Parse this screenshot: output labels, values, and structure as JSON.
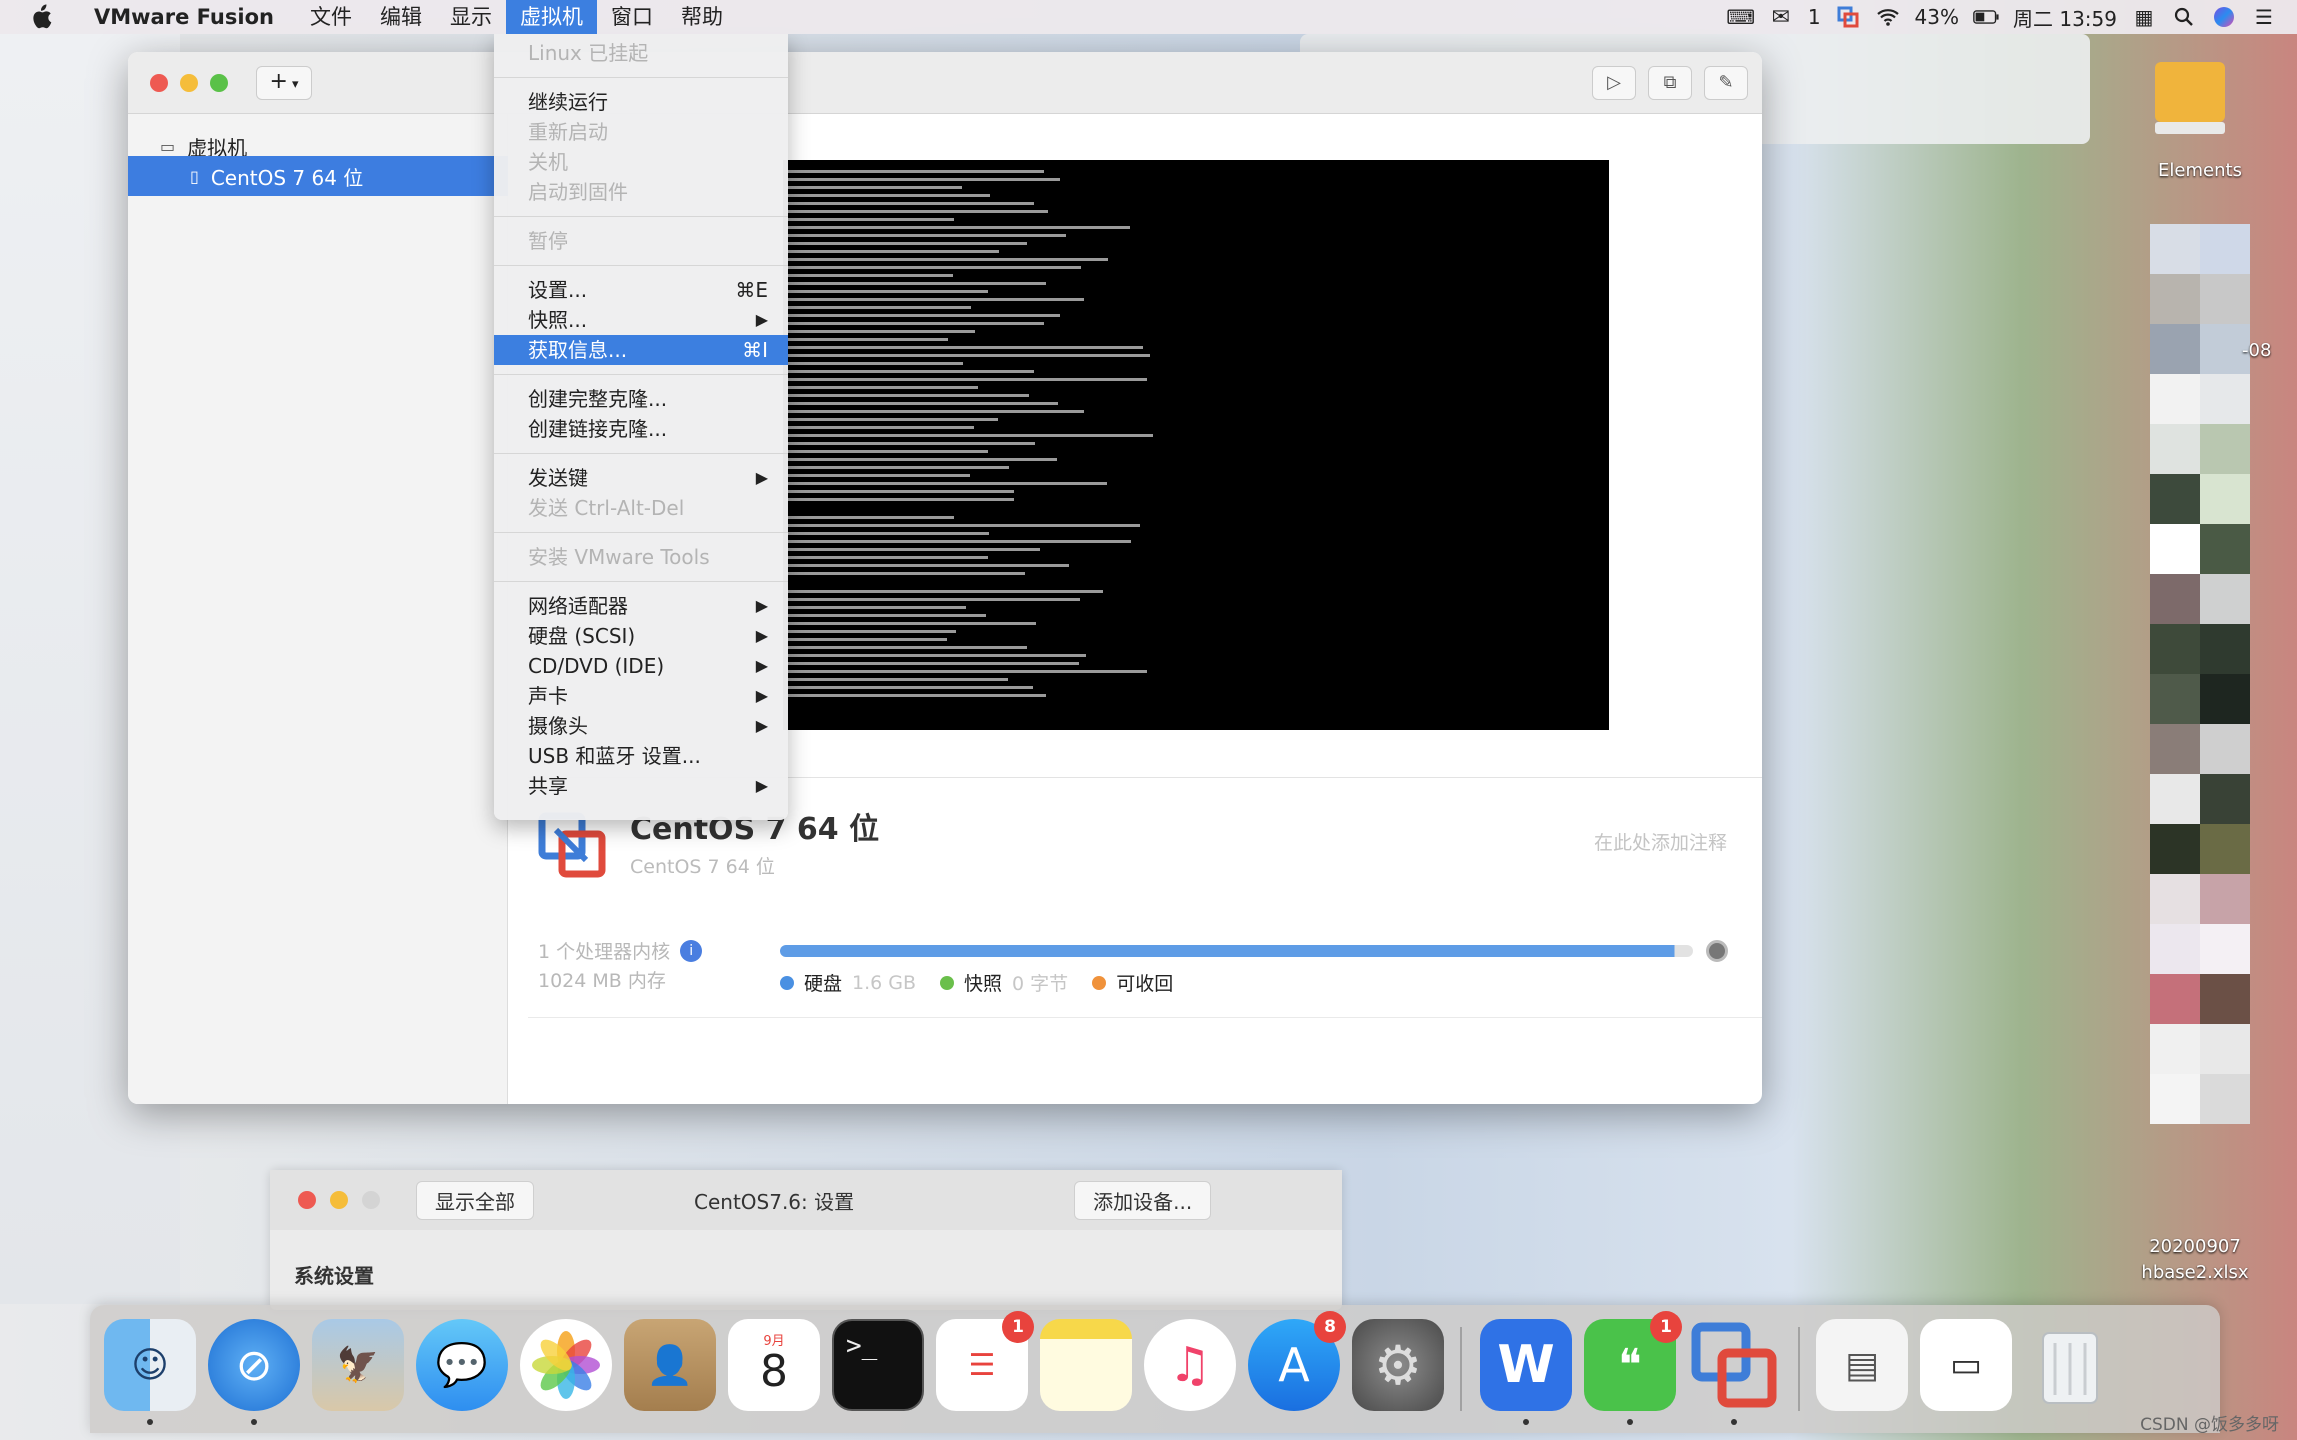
{
  "menubar": {
    "app_name": "VMware Fusion",
    "items": [
      "文件",
      "编辑",
      "显示",
      "虚拟机",
      "窗口",
      "帮助"
    ],
    "active_index": 3,
    "wechat_count": "1",
    "battery": "43%",
    "clock": "周二 13:59"
  },
  "vm_menu": {
    "header": "Linux 已挂起",
    "group1": [
      "继续运行",
      "重新启动",
      "关机",
      "启动到固件"
    ],
    "pause": "暂停",
    "settings": {
      "label": "设置...",
      "shortcut": "⌘E"
    },
    "snapshot": "快照...",
    "get_info": {
      "label": "获取信息...",
      "shortcut": "⌘I"
    },
    "clone_full": "创建完整克隆...",
    "clone_linked": "创建链接克隆...",
    "send_keys": "发送键",
    "send_cad": "发送 Ctrl-Alt-Del",
    "install_tools": "安装 VMware Tools",
    "hardware": [
      "网络适配器",
      "硬盘 (SCSI)",
      "CD/DVD (IDE)",
      "声卡",
      "摄像头",
      "USB 和蓝牙 设置...",
      "共享"
    ]
  },
  "library": {
    "section": "虚拟机",
    "selected_vm": "CentOS 7 64 位",
    "add_button": "+"
  },
  "vm_detail": {
    "name": "CentOS 7 64 位",
    "os": "CentOS 7 64 位",
    "note_placeholder": "在此处添加注释",
    "cpu": "1 个处理器内核",
    "memory": "1024 MB 内存",
    "storage_used_fraction": 0.98,
    "legend": [
      {
        "label": "硬盘",
        "value": "1.6 GB",
        "color": "#4a90e2"
      },
      {
        "label": "快照",
        "value": "0 字节",
        "color": "#6abf4b"
      },
      {
        "label": "可收回",
        "value": "",
        "color": "#f0923b"
      }
    ]
  },
  "settings_window": {
    "show_all": "显示全部",
    "title": "CentOS7.6: 设置",
    "add_device": "添加设备...",
    "section": "系统设置"
  },
  "desktop": {
    "folder_label": "Elements",
    "file_date": "20200907",
    "file_name": "hbase2.xlsx",
    "partial_labels": [
      "-08"
    ]
  },
  "dock": {
    "calendar_day": "8",
    "calendar_month": "9月",
    "badges": {
      "reminders": "1",
      "appstore": "8",
      "wechat": "1"
    }
  },
  "watermark": "CSDN @饭多多呀"
}
